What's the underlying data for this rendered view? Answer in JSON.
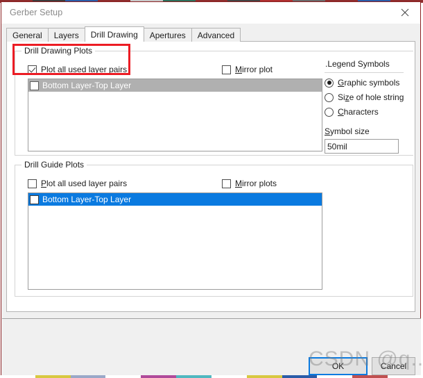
{
  "window": {
    "title": "Gerber Setup",
    "close_icon": "close-icon"
  },
  "tabs": [
    {
      "label": "General",
      "active": false
    },
    {
      "label": "Layers",
      "active": false
    },
    {
      "label": "Drill Drawing",
      "active": true
    },
    {
      "label": "Apertures",
      "active": false
    },
    {
      "label": "Advanced",
      "active": false
    }
  ],
  "drill_drawing_plots": {
    "group_title": "Drill Drawing Plots",
    "plot_all_label": "Plot all used layer pairs",
    "plot_all_checked": true,
    "mirror_label": "Mirror plot",
    "mirror_checked": false,
    "list_items": [
      {
        "label": "Bottom Layer-Top Layer",
        "checked": false,
        "selected": true
      }
    ]
  },
  "legend_symbols": {
    "heading": ".Legend Symbols",
    "options": [
      {
        "label": "Graphic symbols",
        "selected": true
      },
      {
        "label": "Size of hole string",
        "selected": false
      },
      {
        "label": "Characters",
        "selected": false
      }
    ],
    "symbol_size_label": "Symbol size",
    "symbol_size_value": "50mil",
    "symbol_size_placeholder": ""
  },
  "drill_guide_plots": {
    "group_title": "Drill Guide Plots",
    "plot_all_label": "Plot all used layer pairs",
    "plot_all_checked": false,
    "mirror_label": "Mirror plots",
    "mirror_checked": false,
    "list_items": [
      {
        "label": "Bottom Layer-Top Layer",
        "checked": false,
        "selected": true
      }
    ]
  },
  "footer": {
    "ok_label": "OK",
    "cancel_label": "Cancel"
  },
  "annotation": {
    "highlight_color": "#ec1c24"
  },
  "watermark": {
    "text": "CSDN @q..."
  },
  "colors": {
    "selection_active": "#0a7ae0",
    "selection_inactive": "#b0b0b0",
    "window_border": "#8b2122",
    "dialog_bg": "#f0f0f0"
  },
  "edge_strip": {
    "top": [
      "#8f2d2d",
      "#3c3c3c",
      "#2a5ca8",
      "#8f2d2d",
      "#c8c8c8",
      "#2d6e5a",
      "#8f2d2d",
      "#444444",
      "#b03030",
      "#6a6a6a",
      "#8f2d2d",
      "#2a5ca8",
      "#8f2d2d"
    ],
    "bottom": [
      "#ffffff",
      "#d8c840",
      "#9aa8c8",
      "#ffffff",
      "#b04a9a",
      "#50b8c0",
      "#ffffff",
      "#d8c840",
      "#2a5ca8",
      "#ffffff",
      "#c05050",
      "#ffffff"
    ]
  }
}
